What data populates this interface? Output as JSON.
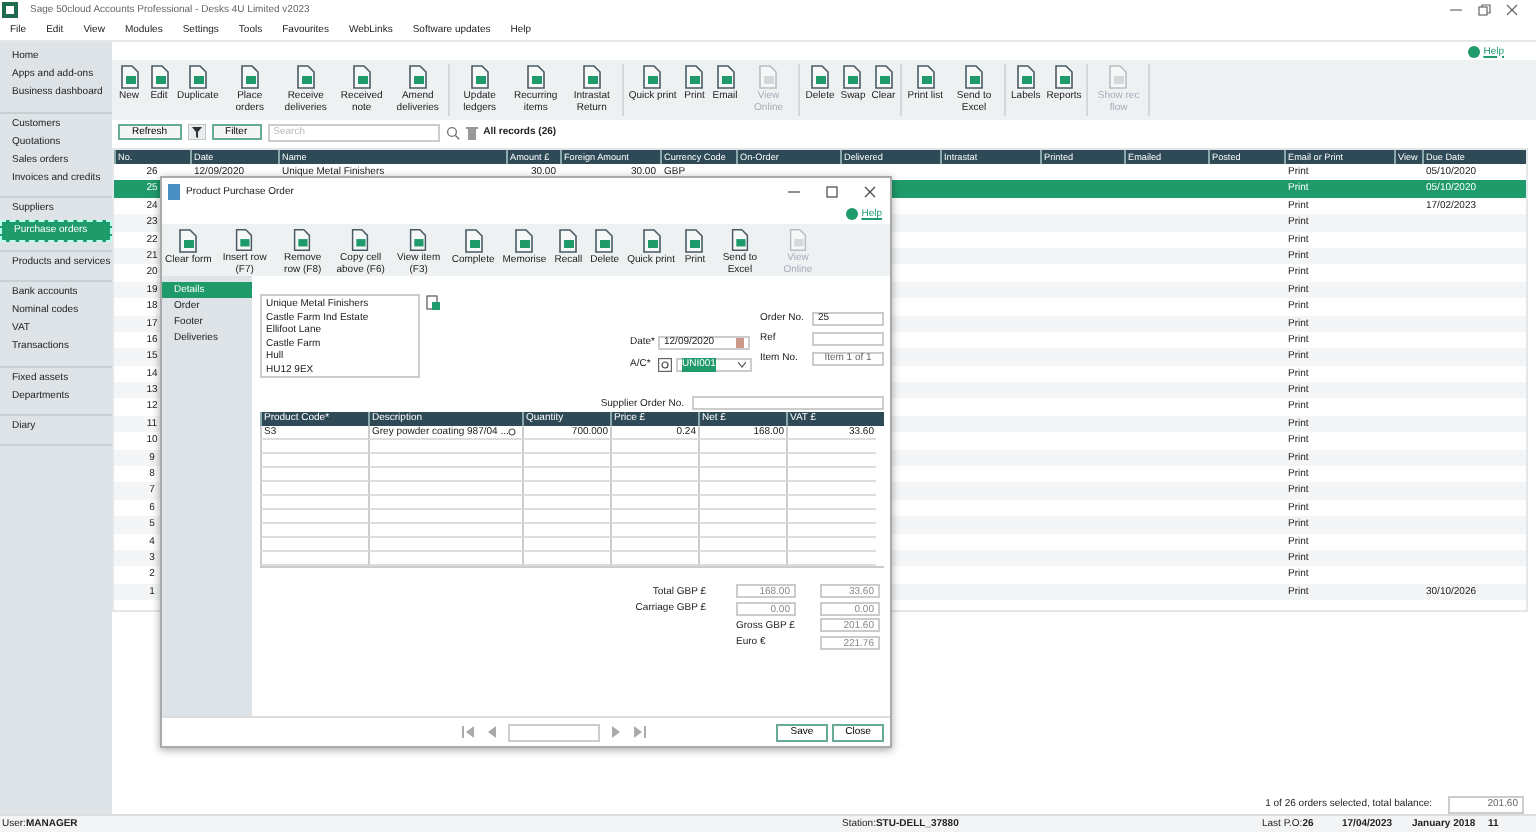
{
  "window": {
    "title": "Sage 50cloud Accounts Professional - Desks 4U Limited v2023"
  },
  "menu": [
    "File",
    "Edit",
    "View",
    "Modules",
    "Settings",
    "Tools",
    "Favourites",
    "WebLinks",
    "Software updates",
    "Help"
  ],
  "help_link": "Help",
  "sidebar": {
    "groups": [
      {
        "items": [
          {
            "label": "Home",
            "selected": false
          },
          {
            "label": "Apps and add-ons",
            "selected": false
          },
          {
            "label": "Business dashboard",
            "selected": false
          }
        ]
      },
      {
        "items": [
          {
            "label": "Customers",
            "selected": false
          },
          {
            "label": "Quotations",
            "selected": false
          },
          {
            "label": "Sales orders",
            "selected": false
          },
          {
            "label": "Invoices and credits",
            "selected": false
          }
        ]
      },
      {
        "items": [
          {
            "label": "Suppliers",
            "selected": false
          },
          {
            "label": "Purchase orders",
            "selected": true
          }
        ]
      },
      {
        "items": [
          {
            "label": "Products and services",
            "selected": false
          }
        ]
      },
      {
        "items": [
          {
            "label": "Bank accounts",
            "selected": false
          },
          {
            "label": "Nominal codes",
            "selected": false
          },
          {
            "label": "VAT",
            "selected": false
          },
          {
            "label": "Transactions",
            "selected": false
          }
        ]
      },
      {
        "items": [
          {
            "label": "Fixed assets",
            "selected": false
          },
          {
            "label": "Departments",
            "selected": false
          }
        ]
      },
      {
        "items": [
          {
            "label": "Diary",
            "selected": false
          }
        ]
      }
    ]
  },
  "toolbar": {
    "groups": [
      {
        "buttons": [
          {
            "label": "New",
            "disabled": false
          },
          {
            "label": "Edit",
            "disabled": false
          },
          {
            "label": "Duplicate",
            "disabled": false
          },
          {
            "label": "Place orders",
            "disabled": false
          },
          {
            "label": "Receive deliveries",
            "disabled": false
          },
          {
            "label": "Received note",
            "disabled": false
          },
          {
            "label": "Amend deliveries",
            "disabled": false
          }
        ]
      },
      {
        "buttons": [
          {
            "label": "Update ledgers",
            "disabled": false
          },
          {
            "label": "Recurring items",
            "disabled": false
          },
          {
            "label": "Intrastat Return",
            "disabled": false
          }
        ]
      },
      {
        "buttons": [
          {
            "label": "Quick print",
            "disabled": false
          },
          {
            "label": "Print",
            "disabled": false
          },
          {
            "label": "Email",
            "disabled": false
          },
          {
            "label": "View Online",
            "disabled": true
          }
        ]
      },
      {
        "buttons": [
          {
            "label": "Delete",
            "disabled": false
          },
          {
            "label": "Swap",
            "disabled": false
          },
          {
            "label": "Clear",
            "disabled": false
          }
        ]
      },
      {
        "buttons": [
          {
            "label": "Print list",
            "disabled": false
          },
          {
            "label": "Send to Excel",
            "disabled": false
          }
        ]
      },
      {
        "buttons": [
          {
            "label": "Labels",
            "disabled": false
          },
          {
            "label": "Reports",
            "disabled": false
          }
        ]
      },
      {
        "buttons": [
          {
            "label": "Show rec flow",
            "disabled": true
          }
        ]
      }
    ]
  },
  "filter_bar": {
    "refresh_button": "Refresh",
    "filter_button": "Filter",
    "search": {
      "placeholder": "Search"
    },
    "record_count": "All records (26)"
  },
  "table": {
    "columns": [
      "No.",
      "Date",
      "Name",
      "Amount £",
      "Foreign Amount",
      "Currency Code",
      "On-Order",
      "Delivered",
      "Intrastat",
      "Printed",
      "Emailed",
      "Posted",
      "Email or Print",
      "View",
      "Due Date"
    ],
    "rows": [
      {
        "no": "26",
        "date": "12/09/2020",
        "name": "Unique Metal Finishers",
        "amount": "30.00",
        "foreign_amount": "30.00",
        "currency_code": "GBP",
        "email_or_print": "Print",
        "due_date": "05/10/2020",
        "selected": false
      },
      {
        "no": "25",
        "email_or_print": "Print",
        "due_date": "05/10/2020",
        "selected": true
      },
      {
        "no": "24",
        "email_or_print": "Print",
        "due_date": "17/02/2023",
        "selected": false
      },
      {
        "no": "23",
        "email_or_print": "Print",
        "selected": false
      },
      {
        "no": "22",
        "email_or_print": "Print",
        "selected": false
      },
      {
        "no": "21",
        "email_or_print": "Print",
        "selected": false
      },
      {
        "no": "20",
        "email_or_print": "Print",
        "selected": false
      },
      {
        "no": "19",
        "email_or_print": "Print",
        "selected": false
      },
      {
        "no": "18",
        "email_or_print": "Print",
        "selected": false
      },
      {
        "no": "17",
        "email_or_print": "Print",
        "selected": false
      },
      {
        "no": "16",
        "email_or_print": "Print",
        "selected": false
      },
      {
        "no": "15",
        "email_or_print": "Print",
        "selected": false
      },
      {
        "no": "14",
        "email_or_print": "Print",
        "selected": false
      },
      {
        "no": "13",
        "email_or_print": "Print",
        "selected": false
      },
      {
        "no": "12",
        "email_or_print": "Print",
        "selected": false
      },
      {
        "no": "11",
        "email_or_print": "Print",
        "selected": false
      },
      {
        "no": "10",
        "email_or_print": "Print",
        "selected": false
      },
      {
        "no": "9",
        "email_or_print": "Print",
        "selected": false
      },
      {
        "no": "8",
        "email_or_print": "Print",
        "selected": false
      },
      {
        "no": "7",
        "email_or_print": "Print",
        "selected": false
      },
      {
        "no": "6",
        "email_or_print": "Print",
        "selected": false
      },
      {
        "no": "5",
        "email_or_print": "Print",
        "selected": false
      },
      {
        "no": "4",
        "email_or_print": "Print",
        "selected": false
      },
      {
        "no": "3",
        "email_or_print": "Print",
        "selected": false
      },
      {
        "no": "2",
        "email_or_print": "Print",
        "selected": false
      },
      {
        "no": "1",
        "email_or_print": "Print",
        "due_date": "30/10/2026",
        "selected": false
      }
    ]
  },
  "summary": {
    "text": "1 of 26 orders selected, total balance:",
    "value": "201.60"
  },
  "status_bar": [
    {
      "label": "User:",
      "value": "MANAGER"
    },
    {
      "label": "Station:",
      "value": "STU-DELL_37880"
    },
    {
      "label": "Last P.O:",
      "value": "26"
    },
    {
      "value": "17/04/2023"
    },
    {
      "value": "January 2018"
    },
    {
      "value": "11"
    }
  ],
  "dialog": {
    "title": "Product Purchase Order",
    "help_link": "Help",
    "toolbar": [
      {
        "label": "Clear form",
        "disabled": false
      },
      {
        "label": "Insert row (F7)",
        "disabled": false
      },
      {
        "label": "Remove row (F8)",
        "disabled": false
      },
      {
        "label": "Copy cell above (F6)",
        "disabled": false
      },
      {
        "label": "View item (F3)",
        "disabled": false
      },
      {
        "label": "Complete",
        "disabled": false
      },
      {
        "label": "Memorise",
        "disabled": false
      },
      {
        "label": "Recall",
        "disabled": false
      },
      {
        "label": "Delete",
        "disabled": false
      },
      {
        "label": "Quick print",
        "disabled": false
      },
      {
        "label": "Print",
        "disabled": false
      },
      {
        "label": "Send to Excel",
        "disabled": false
      },
      {
        "label": "View Online",
        "disabled": true
      }
    ],
    "nav": [
      {
        "label": "Details",
        "selected": true
      },
      {
        "label": "Order",
        "selected": false
      },
      {
        "label": "Footer",
        "selected": false
      },
      {
        "label": "Deliveries",
        "selected": false
      }
    ],
    "address": [
      "Unique Metal Finishers",
      "Castle Farm Ind Estate",
      "Ellifoot Lane",
      "Castle Farm",
      "Hull",
      "HU12 9EX"
    ],
    "date": {
      "label": "Date*",
      "value": "12/09/2020"
    },
    "account": {
      "label": "A/C*",
      "value": "UNI001"
    },
    "order_no": {
      "label": "Order No.",
      "value": "25"
    },
    "ref": {
      "label": "Ref"
    },
    "item_no": {
      "label": "Item No.",
      "value": "Item 1 of 1"
    },
    "supplier_order_no": {
      "label": "Supplier Order No."
    },
    "lines": {
      "columns": [
        "Product Code*",
        "Description",
        "Quantity",
        "Price £",
        "Net £",
        "VAT £"
      ],
      "rows": [
        [
          "S3",
          "Grey powder coating 987/04 ...",
          "700.000",
          "0.24",
          "168.00",
          "33.60"
        ]
      ]
    },
    "totals": {
      "total_label": "Total GBP £",
      "total_net": "168.00",
      "total_vat": "33.60",
      "carriage_label": "Carriage GBP £",
      "carriage_net": "0.00",
      "carriage_vat": "0.00",
      "gross_label": "Gross GBP £",
      "gross": "201.60",
      "euro_label": "Euro €",
      "euro": "221.76"
    },
    "buttons": [
      "Save",
      "Close"
    ]
  }
}
